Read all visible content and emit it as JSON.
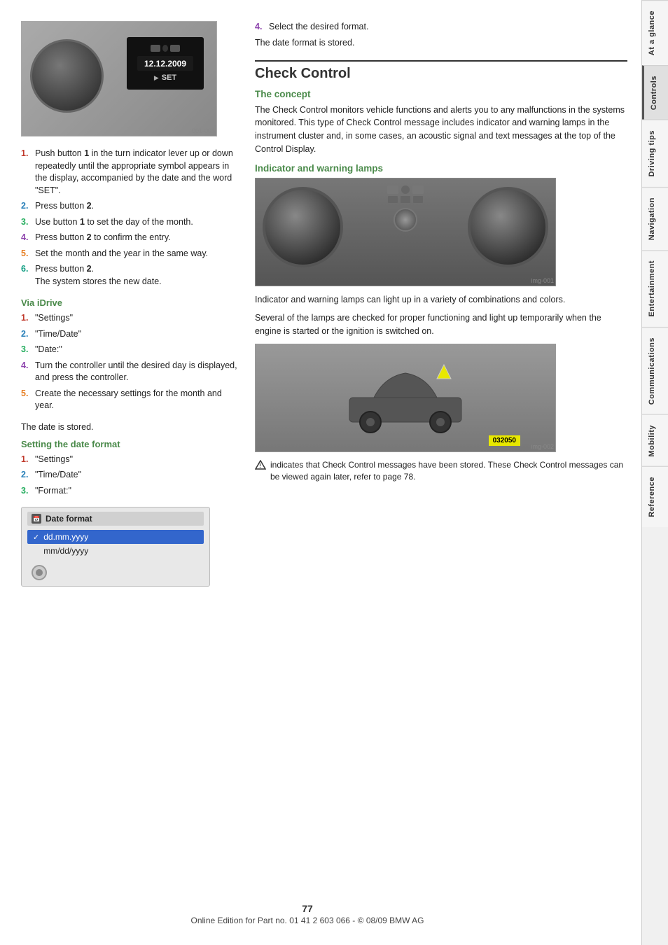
{
  "page": {
    "number": "77",
    "footer_text": "Online Edition for Part no. 01 41 2 603 066 - © 08/09 BMW AG"
  },
  "sidebar": {
    "tabs": [
      {
        "id": "at-a-glance",
        "label": "At a glance",
        "active": false
      },
      {
        "id": "controls",
        "label": "Controls",
        "active": true
      },
      {
        "id": "driving-tips",
        "label": "Driving tips",
        "active": false
      },
      {
        "id": "navigation",
        "label": "Navigation",
        "active": false
      },
      {
        "id": "entertainment",
        "label": "Entertainment",
        "active": false
      },
      {
        "id": "communications",
        "label": "Communications",
        "active": false
      },
      {
        "id": "mobility",
        "label": "Mobility",
        "active": false
      },
      {
        "id": "reference",
        "label": "Reference",
        "active": false
      }
    ]
  },
  "left_column": {
    "step4_prefix": "4.",
    "step4_text": "Select the desired format.",
    "stored_note": "The date format is stored.",
    "section_main_title": "Check Control",
    "section_concept_title": "The concept",
    "concept_text": "The Check Control monitors vehicle functions and alerts you to any malfunctions in the systems monitored. This type of Check Control message includes indicator and warning lamps in the instrument cluster and, in some cases, an acoustic signal and text messages at the top of the Control Display.",
    "indicator_lamps_title": "Indicator and warning lamps",
    "indicator_text1": "Indicator and warning lamps can light up in a variety of combinations and colors.",
    "indicator_text2": "Several of the lamps are checked for proper functioning and light up temporarily when the engine is started or the ignition is switched on.",
    "warning_note_text": "indicates that Check Control messages have been stored. These Check Control messages can be viewed again later, refer to page 78."
  },
  "date_image": {
    "date_text": "12.12.2009",
    "set_text": "SET"
  },
  "steps_main": [
    {
      "num": "1.",
      "color": "1",
      "text": "Push button 1 in the turn indicator lever up or down repeatedly until the appropriate symbol appears in the display, accompanied by the date and the word \"SET\"."
    },
    {
      "num": "2.",
      "color": "2",
      "text": "Press button 2."
    },
    {
      "num": "3.",
      "color": "3",
      "text": "Use button 1 to set the day of the month."
    },
    {
      "num": "4.",
      "color": "4",
      "text": "Press button 2 to confirm the entry."
    },
    {
      "num": "5.",
      "color": "5",
      "text": "Set the month and the year in the same way."
    },
    {
      "num": "6.",
      "color": "6",
      "text": "Press button 2.\nThe system stores the new date."
    }
  ],
  "via_idrive": {
    "title": "Via iDrive",
    "steps": [
      {
        "num": "1.",
        "color": "1",
        "text": "\"Settings\""
      },
      {
        "num": "2.",
        "color": "2",
        "text": "\"Time/Date\""
      },
      {
        "num": "3.",
        "color": "3",
        "text": "\"Date:\""
      },
      {
        "num": "4.",
        "color": "4",
        "text": "Turn the controller until the desired day is displayed, and press the controller."
      },
      {
        "num": "5.",
        "color": "5",
        "text": "Create the necessary settings for the month and year."
      }
    ],
    "stored_note": "The date is stored."
  },
  "date_format": {
    "title": "Setting the date format",
    "steps": [
      {
        "num": "1.",
        "color": "1",
        "text": "\"Settings\""
      },
      {
        "num": "2.",
        "color": "2",
        "text": "\"Time/Date\""
      },
      {
        "num": "3.",
        "color": "3",
        "text": "\"Format:\""
      }
    ],
    "dialog": {
      "title": "Date format",
      "option1": "✓ dd.mm.yyyy",
      "option2": "mm/dd/yyyy"
    }
  }
}
